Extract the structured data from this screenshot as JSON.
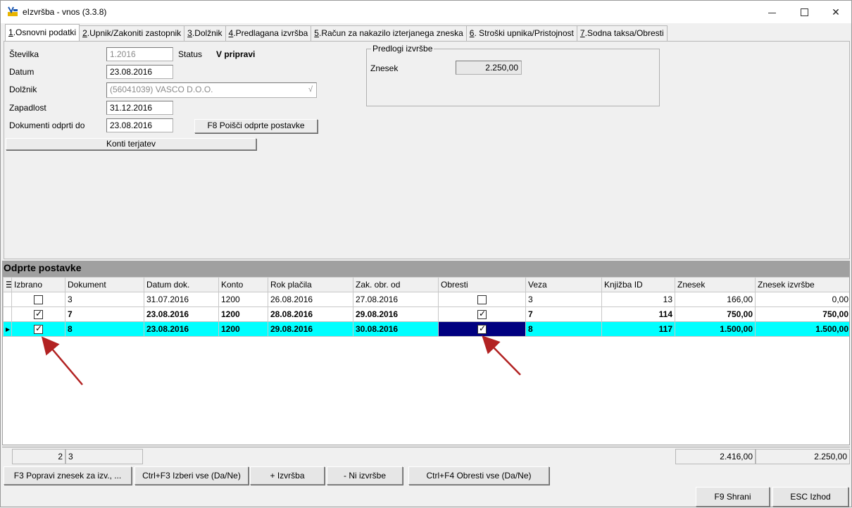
{
  "window": {
    "title": "eIzvršba - vnos  (3.3.8)"
  },
  "tabs": [
    {
      "num": "1",
      "label": ".Osnovni podatki",
      "active": true
    },
    {
      "num": "2",
      "label": ".Upnik/Zakoniti zastopnik"
    },
    {
      "num": "3",
      "label": ".Dolžnik"
    },
    {
      "num": "4",
      "label": ".Predlagana izvršba"
    },
    {
      "num": "5",
      "label": ".Račun za nakazilo izterjanega zneska"
    },
    {
      "num": "6",
      "label": ". Stroški upnika/Pristojnost"
    },
    {
      "num": "7",
      "label": ".Sodna taksa/Obresti"
    }
  ],
  "form": {
    "stevilka_label": "Številka",
    "stevilka_value": "1.2016",
    "status_label": "Status",
    "status_value": "V pripravi",
    "datum_label": "Datum",
    "datum_value": "23.08.2016",
    "dolznik_label": "Dolžnik",
    "dolznik_value": "(56041039) VASCO D.O.O.",
    "zapadlost_label": "Zapadlost",
    "zapadlost_value": "31.12.2016",
    "dokumenti_label": "Dokumenti odprti do",
    "dokumenti_value": "23.08.2016",
    "find_button": "F8 Poišči odprte postavke",
    "konti_button": "Konti terjatev"
  },
  "predlogi": {
    "title": "Predlogi izvršbe",
    "znesek_label": "Znesek",
    "znesek_value": "2.250,00"
  },
  "grid": {
    "caption": "Odprte postavke",
    "columns": [
      "Izbrano",
      "Dokument",
      "Datum dok.",
      "Konto",
      "Rok plačila",
      "Zak. obr. od",
      "Obresti",
      "Veza",
      "Knjižba ID",
      "Znesek",
      "Znesek izvršbe"
    ],
    "rows": [
      {
        "izbrano": false,
        "dokument": "3",
        "datum": "31.07.2016",
        "konto": "1200",
        "rok": "26.08.2016",
        "zak": "27.08.2016",
        "obresti": false,
        "veza": "3",
        "knjizba": "13",
        "znesek": "166,00",
        "izvrsba": "0,00"
      },
      {
        "izbrano": true,
        "dokument": "7",
        "datum": "23.08.2016",
        "konto": "1200",
        "rok": "28.08.2016",
        "zak": "29.08.2016",
        "obresti": true,
        "veza": "7",
        "knjizba": "114",
        "znesek": "750,00",
        "izvrsba": "750,00"
      },
      {
        "izbrano": true,
        "dokument": "8",
        "datum": "23.08.2016",
        "konto": "1200",
        "rok": "29.08.2016",
        "zak": "30.08.2016",
        "obresti": true,
        "veza": "8",
        "knjizba": "117",
        "znesek": "1.500,00",
        "izvrsba": "1.500,00"
      }
    ]
  },
  "footer": {
    "count_selected": "2",
    "count_rows": "3",
    "sum_znesek": "2.416,00",
    "sum_izvrsba": "2.250,00"
  },
  "buttons": {
    "f3": "F3 Popravi znesek za izv., ...",
    "ctrl_f3": "Ctrl+F3 Izberi vse (Da/Ne)",
    "plus": "+ Izvršba",
    "minus": "- Ni izvršbe",
    "ctrl_f4": "Ctrl+F4 Obresti vse (Da/Ne)",
    "save": "F9 Shrani",
    "exit": "ESC Izhod"
  },
  "colors": {
    "selected_row": "#00ffff",
    "focused_cell": "#000080",
    "annotation_arrow": "#b22222"
  }
}
